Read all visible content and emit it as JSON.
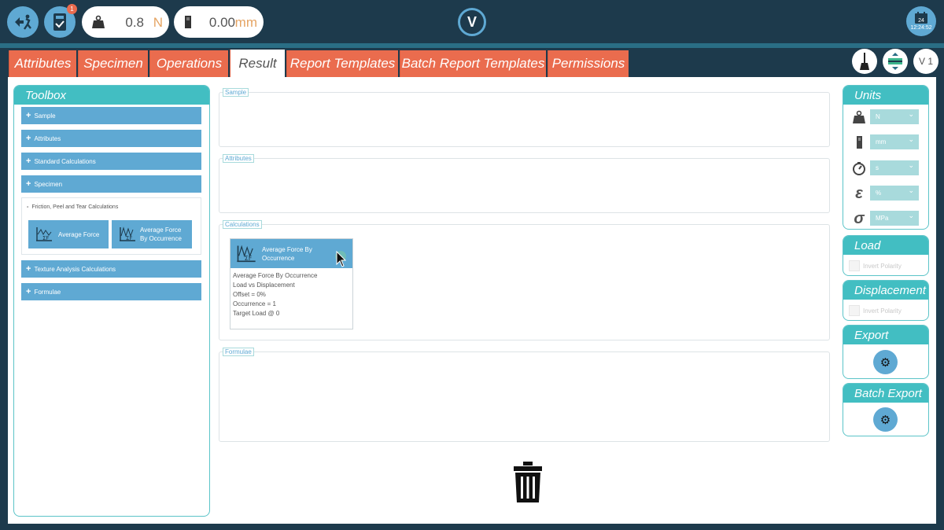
{
  "topbar": {
    "notification_count": "1",
    "force": {
      "value": "0.8",
      "unit": "N"
    },
    "displacement": {
      "value": "0.00",
      "unit": "mm"
    },
    "logo_text": "V",
    "clock": {
      "day": "24",
      "time": "12:24:52"
    }
  },
  "tabs": [
    {
      "label": "Attributes",
      "active": false
    },
    {
      "label": "Specimen",
      "active": false
    },
    {
      "label": "Operations",
      "active": false
    },
    {
      "label": "Result",
      "active": true
    },
    {
      "label": "Report Templates",
      "active": false
    },
    {
      "label": "Batch Report Templates",
      "active": false
    },
    {
      "label": "Permissions",
      "active": false
    }
  ],
  "version_label": "V 1",
  "toolbox": {
    "title": "Toolbox",
    "items": [
      "Sample",
      "Attributes",
      "Standard Calculations",
      "Specimen",
      "Texture Analysis Calculations",
      "Formulae"
    ],
    "expanded_group": {
      "title": "Friction, Peel and Tear Calculations",
      "buttons": [
        "Average Force",
        "Average Force\nBy Occurrence"
      ]
    }
  },
  "sections": {
    "sample": "Sample",
    "attributes": "Attributes",
    "calculations": "Calculations",
    "formulae": "Formulae"
  },
  "result_card": {
    "title": "Average Force By Occurrence",
    "lines": [
      "Average Force By Occurrence",
      "Load vs Displacement",
      "Offset = 0%",
      "Occurrence = 1",
      "Target Load @ 0"
    ]
  },
  "units": {
    "title": "Units",
    "rows": [
      {
        "icon": "weight-icon",
        "value": "N"
      },
      {
        "icon": "length-icon",
        "value": "mm"
      },
      {
        "icon": "timer-icon",
        "value": "s"
      },
      {
        "icon": "strain-icon",
        "value": "%"
      },
      {
        "icon": "stress-icon",
        "value": "MPa"
      }
    ]
  },
  "load": {
    "title": "Load",
    "checkbox_label": "Invert Polarity"
  },
  "displacement": {
    "title": "Displacement",
    "checkbox_label": "Invert Polarity"
  },
  "export": {
    "title": "Export"
  },
  "batch_export": {
    "title": "Batch Export"
  },
  "colors": {
    "accent": "#5fa9d3",
    "tab": "#ea6c4e",
    "panel_header": "#42bec2",
    "background": "#1d3a4c"
  }
}
